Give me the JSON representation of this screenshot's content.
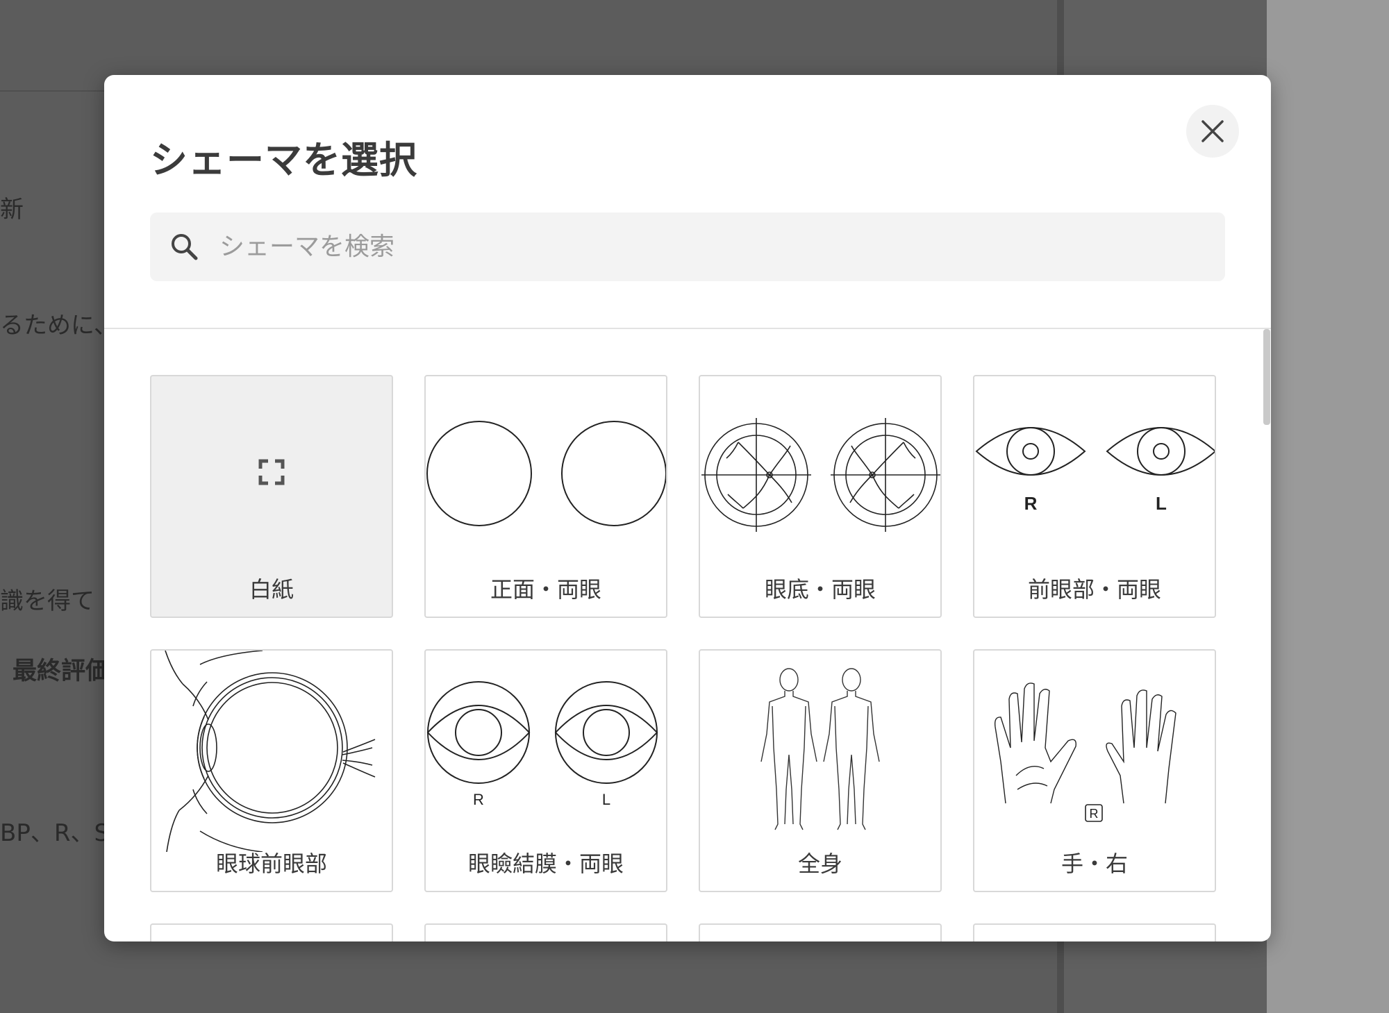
{
  "background": {
    "fragments": [
      "新",
      "るために、",
      "識を得て",
      "最終評価",
      "BP、R、S"
    ]
  },
  "modal": {
    "title": "シェーマを選択",
    "close_label": "×",
    "search": {
      "placeholder": "シェーマを検索",
      "value": ""
    },
    "cards": [
      {
        "label": "白紙",
        "icon": "blank-expand-icon"
      },
      {
        "label": "正面・両眼",
        "icon": "front-both-eyes-circles"
      },
      {
        "label": "眼底・両眼",
        "icon": "fundus-both-eyes"
      },
      {
        "label": "前眼部・両眼",
        "icon": "anterior-segment-both-eyes",
        "marks": [
          "R",
          "L"
        ]
      },
      {
        "label": "眼球前眼部",
        "icon": "eyeball-cross-section"
      },
      {
        "label": "眼瞼結膜・両眼",
        "icon": "eyelid-conjunctiva-both-eyes",
        "marks": [
          "R",
          "L"
        ]
      },
      {
        "label": "全身",
        "icon": "full-body-front-back"
      },
      {
        "label": "手・右",
        "icon": "right-hand",
        "marks": [
          "R"
        ]
      }
    ]
  }
}
